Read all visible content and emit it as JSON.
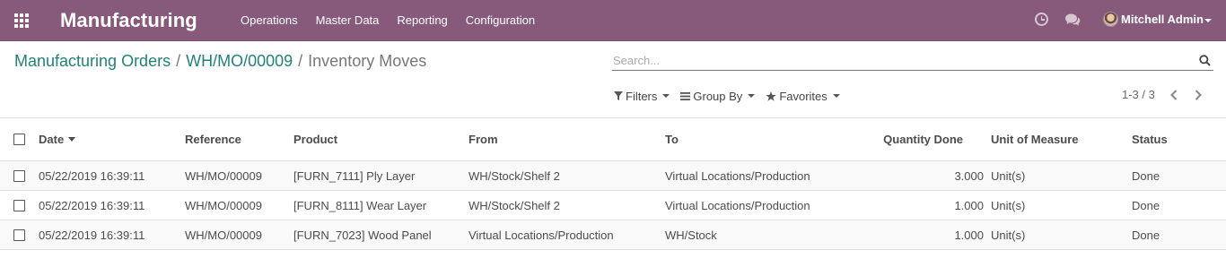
{
  "navbar": {
    "apps_icon": "apps-grid-icon",
    "brand": "Manufacturing",
    "menu": [
      "Operations",
      "Master Data",
      "Reporting",
      "Configuration"
    ],
    "activity_icon": "clock-icon",
    "chat_icon": "chat-icon",
    "user_name": "Mitchell Admin",
    "accent_color": "#875a7b"
  },
  "breadcrumb": {
    "items": [
      "Manufacturing Orders",
      "WH/MO/00009"
    ],
    "separator": "/",
    "current": "Inventory Moves"
  },
  "search": {
    "placeholder": "Search...",
    "value": "",
    "icon": "search-icon"
  },
  "filters": {
    "filters_label": "Filters",
    "group_by_label": "Group By",
    "favorites_label": "Favorites"
  },
  "pager": {
    "range": "1-3 / 3"
  },
  "table": {
    "columns": [
      "Date",
      "Reference",
      "Product",
      "From",
      "To",
      "Quantity Done",
      "Unit of Measure",
      "Status"
    ],
    "rows": [
      [
        "05/22/2019 16:39:11",
        "WH/MO/00009",
        "[FURN_7111] Ply Layer",
        "WH/Stock/Shelf 2",
        "Virtual Locations/Production",
        "3.000",
        "Unit(s)",
        "Done"
      ],
      [
        "05/22/2019 16:39:11",
        "WH/MO/00009",
        "[FURN_8111] Wear Layer",
        "WH/Stock/Shelf 2",
        "Virtual Locations/Production",
        "1.000",
        "Unit(s)",
        "Done"
      ],
      [
        "05/22/2019 16:39:11",
        "WH/MO/00009",
        "[FURN_7023] Wood Panel",
        "Virtual Locations/Production",
        "WH/Stock",
        "1.000",
        "Unit(s)",
        "Done"
      ]
    ]
  }
}
